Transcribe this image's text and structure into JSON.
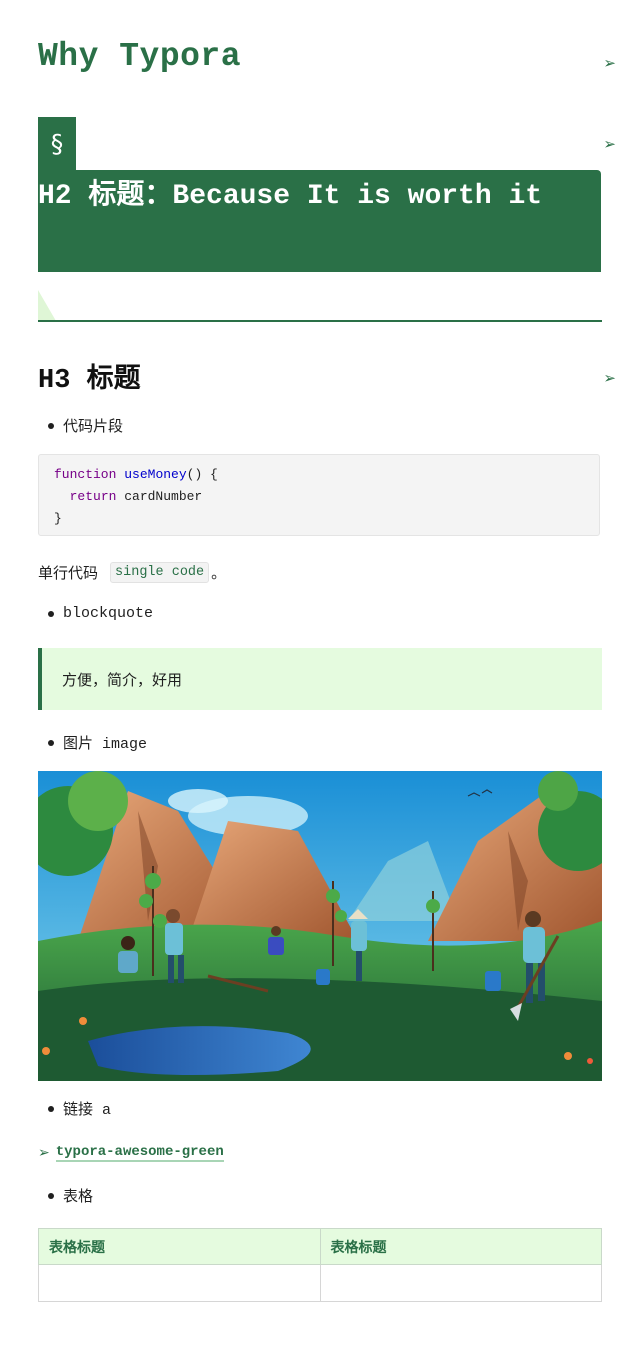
{
  "h1": {
    "title": "Why Typora"
  },
  "h2": {
    "section_symbol": "§",
    "title": "H2 标题：Because It is worth it"
  },
  "h3": {
    "title": "H3 标题"
  },
  "anchor_glyph": "➢",
  "list": {
    "code_item": "代码片段",
    "blockquote_item": "blockquote",
    "image_item": "图片 image",
    "link_item": "链接 a",
    "table_item": "表格"
  },
  "code_block": {
    "keyword_function": "function",
    "function_name": "useMoney",
    "line1_rest": "() {",
    "keyword_return": "return",
    "line2_rest": " cardNumber",
    "line3": "}"
  },
  "inline": {
    "prefix": "单行代码",
    "code": "single code",
    "suffix": "。"
  },
  "blockquote": {
    "text": "方便，简介，好用"
  },
  "link": {
    "arrow": "➢",
    "text": "typora-awesome-green"
  },
  "table": {
    "headers": [
      "表格标题",
      "表格标题"
    ],
    "rows": [
      [
        "",
        ""
      ]
    ]
  },
  "colors": {
    "primary": "#2a7047",
    "quote_bg": "#e5fbdf",
    "code_bg": "#f4f4f4"
  }
}
